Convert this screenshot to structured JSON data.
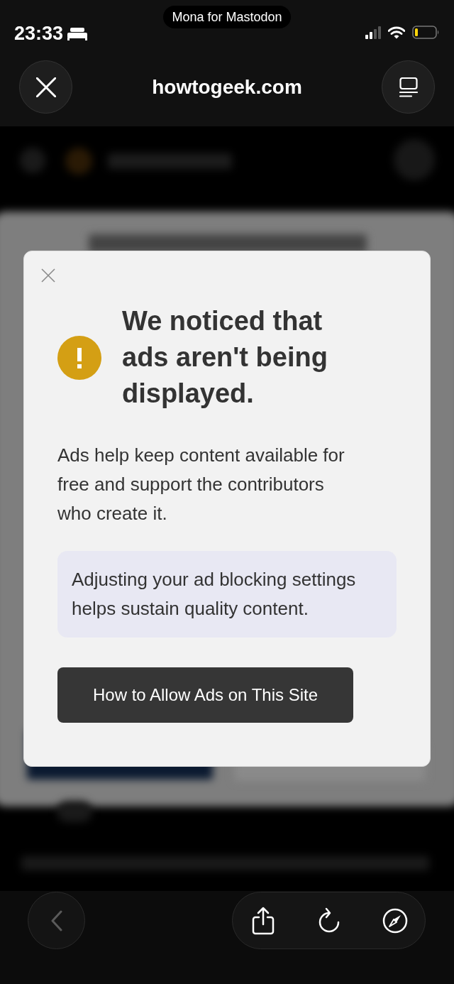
{
  "status_bar": {
    "time": "23:33",
    "app_pill": "Mona for Mastodon"
  },
  "nav_bar": {
    "title": "howtogeek.com"
  },
  "dialog": {
    "title": "We noticed that ads aren't being displayed.",
    "body": "Ads help keep content available for free and support the contributors who create it.",
    "note": "Adjusting your ad blocking settings helps sustain quality content.",
    "button": "How to Allow Ads on This Site"
  },
  "toolbar": {
    "back_button": {
      "disabled": true
    }
  }
}
